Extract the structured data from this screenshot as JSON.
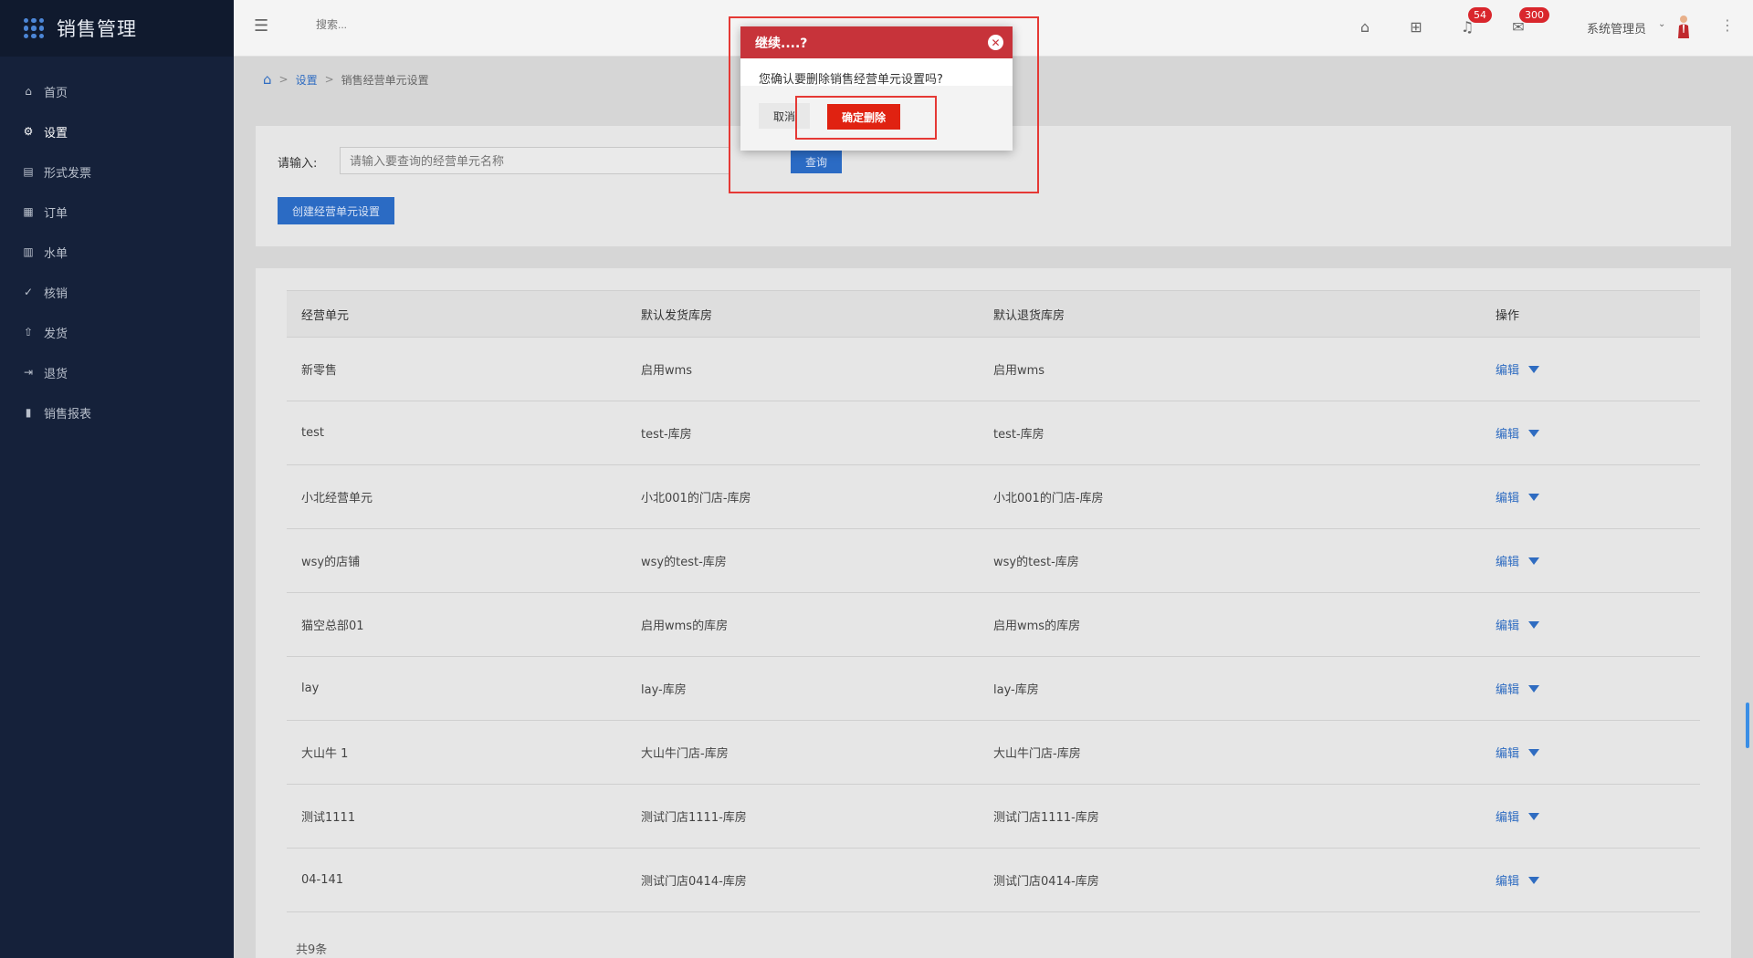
{
  "app": {
    "title": "销售管理"
  },
  "sidebar": {
    "items": [
      {
        "label": "首页",
        "icon": "home-icon"
      },
      {
        "label": "设置",
        "icon": "gear-icon",
        "active": true
      },
      {
        "label": "形式发票",
        "icon": "invoice-icon"
      },
      {
        "label": "订单",
        "icon": "order-icon"
      },
      {
        "label": "水单",
        "icon": "receipt-icon"
      },
      {
        "label": "核销",
        "icon": "check-circle-icon"
      },
      {
        "label": "发货",
        "icon": "upload-icon"
      },
      {
        "label": "退货",
        "icon": "return-icon"
      },
      {
        "label": "销售报表",
        "icon": "bar-chart-icon"
      }
    ]
  },
  "header": {
    "search_placeholder": "搜索...",
    "notifications_count": "54",
    "messages_count": "300",
    "user_name": "系统管理员"
  },
  "breadcrumb": {
    "items": [
      "设置",
      "销售经营单元设置"
    ]
  },
  "filter": {
    "label": "请输入:",
    "placeholder": "请输入要查询的经营单元名称",
    "query_label": "查询",
    "create_label": "创建经营单元设置"
  },
  "table": {
    "columns": [
      "经营单元",
      "默认发货库房",
      "默认退货库房",
      "操作"
    ],
    "rows": [
      {
        "unit": "新零售",
        "ship": "启用wms",
        "return": "启用wms"
      },
      {
        "unit": "test",
        "ship": "test-库房",
        "return": "test-库房"
      },
      {
        "unit": "小北经营单元",
        "ship": "小北001的门店-库房",
        "return": "小北001的门店-库房"
      },
      {
        "unit": "wsy的店铺",
        "ship": "wsy的test-库房",
        "return": "wsy的test-库房"
      },
      {
        "unit": "猫空总部01",
        "ship": "启用wms的库房",
        "return": "启用wms的库房"
      },
      {
        "unit": "lay",
        "ship": "lay-库房",
        "return": "lay-库房"
      },
      {
        "unit": "大山牛 1",
        "ship": "大山牛门店-库房",
        "return": "大山牛门店-库房"
      },
      {
        "unit": "测试1111",
        "ship": "测试门店1111-库房",
        "return": "测试门店1111-库房"
      },
      {
        "unit": "04-141",
        "ship": "测试门店0414-库房",
        "return": "测试门店0414-库房"
      }
    ],
    "edit_label": "编辑",
    "total_label": "共9条"
  },
  "modal": {
    "title": "继续....?",
    "message": "您确认要删除销售经营单元设置吗?",
    "cancel_label": "取消",
    "confirm_label": "确定删除"
  },
  "colors": {
    "sidebar_bg": "#15213a",
    "primary": "#2b6bc4",
    "modal_header": "#c7333a",
    "danger": "#e02211",
    "badge": "#d9262c"
  }
}
